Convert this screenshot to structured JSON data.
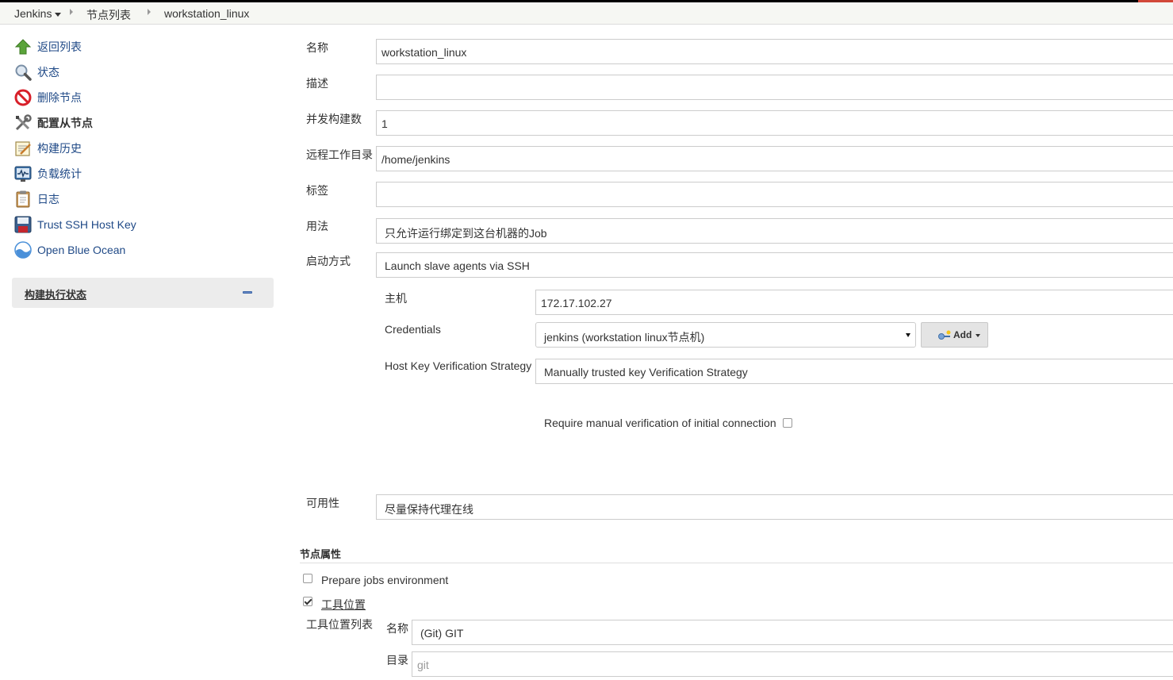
{
  "breadcrumb": {
    "root": "Jenkins",
    "nodes": "节点列表",
    "current": "workstation_linux"
  },
  "sidebar": {
    "items": [
      {
        "label": "返回列表",
        "icon": "up-arrow-icon"
      },
      {
        "label": "状态",
        "icon": "magnifier-icon"
      },
      {
        "label": "删除节点",
        "icon": "no-entry-icon"
      },
      {
        "label": "配置从节点",
        "icon": "tools-icon"
      },
      {
        "label": "构建历史",
        "icon": "notepad-icon"
      },
      {
        "label": "负载统计",
        "icon": "monitor-graph-icon"
      },
      {
        "label": "日志",
        "icon": "clipboard-icon"
      },
      {
        "label": "Trust SSH Host Key",
        "icon": "floppy-disk-icon"
      },
      {
        "label": "Open Blue Ocean",
        "icon": "blue-ocean-icon"
      }
    ],
    "executor_status": "构建执行状态"
  },
  "form": {
    "name_label": "名称",
    "name_value": "workstation_linux",
    "description_label": "描述",
    "description_value": "",
    "executors_label": "并发构建数",
    "executors_value": "1",
    "remote_dir_label": "远程工作目录",
    "remote_dir_value": "/home/jenkins",
    "labels_label": "标签",
    "labels_value": "",
    "usage_label": "用法",
    "usage_value": "只允许运行绑定到这台机器的Job",
    "launch_label": "启动方式",
    "launch_value": "Launch slave agents via SSH",
    "host_label": "主机",
    "host_value": "172.17.102.27",
    "credentials_label": "Credentials",
    "credentials_value": "jenkins (workstation  linux节点机)",
    "add_button": "Add",
    "hkvs_label": "Host Key Verification Strategy",
    "hkvs_value": "Manually trusted key Verification Strategy",
    "require_manual_label": "Require manual verification of initial connection",
    "require_manual_checked": false,
    "availability_label": "可用性",
    "availability_value": "尽量保持代理在线"
  },
  "node_properties": {
    "title": "节点属性",
    "prepare_env_label": "Prepare jobs environment",
    "prepare_env_checked": false,
    "tool_locations_label": "工具位置",
    "tool_locations_checked": true,
    "tool_list_label": "工具位置列表",
    "tool_name_label": "名称",
    "tool_name_value": "(Git) GIT",
    "tool_dir_label": "目录",
    "tool_dir_value": "git"
  }
}
